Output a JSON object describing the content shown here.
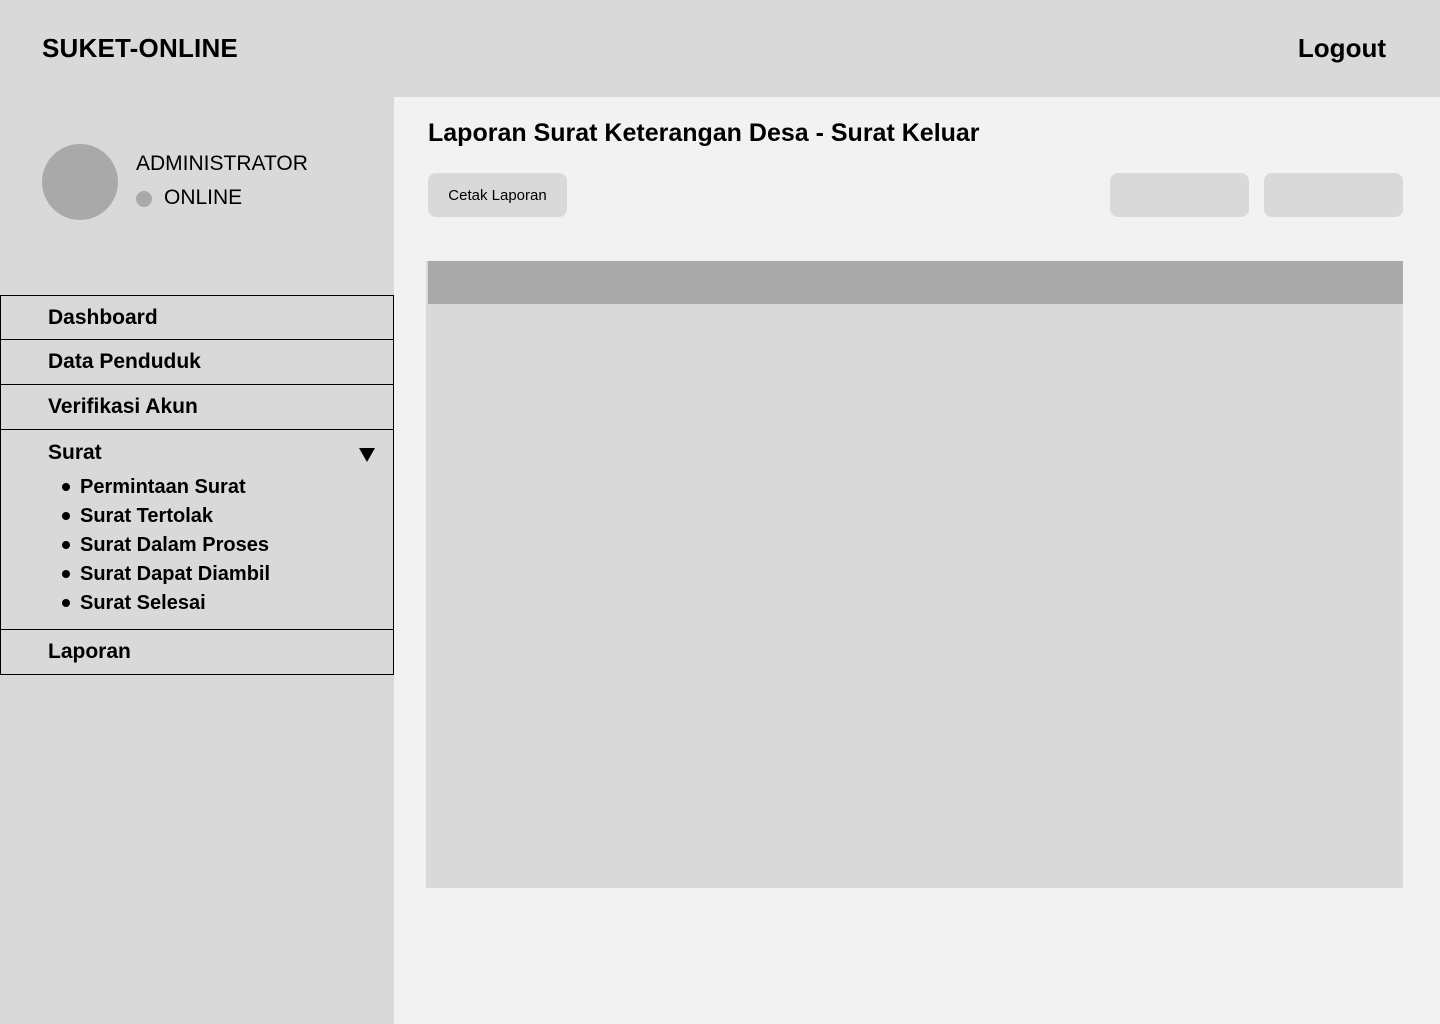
{
  "header": {
    "brand": "SUKET-ONLINE",
    "logout_label": "Logout"
  },
  "user": {
    "name": "ADMINISTRATOR",
    "status": "ONLINE"
  },
  "sidebar": {
    "items": [
      {
        "label": "Dashboard"
      },
      {
        "label": "Data Penduduk"
      },
      {
        "label": "Verifikasi Akun"
      }
    ],
    "group": {
      "label": "Surat",
      "expanded": true,
      "children": [
        {
          "label": "Permintaan Surat"
        },
        {
          "label": "Surat Tertolak"
        },
        {
          "label": "Surat Dalam Proses"
        },
        {
          "label": "Surat Dapat Diambil"
        },
        {
          "label": "Surat Selesai"
        }
      ]
    },
    "last_item": {
      "label": "Laporan"
    }
  },
  "main": {
    "title": "Laporan Surat Keterangan Desa - Surat Keluar",
    "print_button_label": "Cetak Laporan"
  },
  "colors": {
    "panel": "#d9d9d9",
    "accent_gray": "#a9a9a9",
    "content_bg": "#f2f2f2"
  }
}
